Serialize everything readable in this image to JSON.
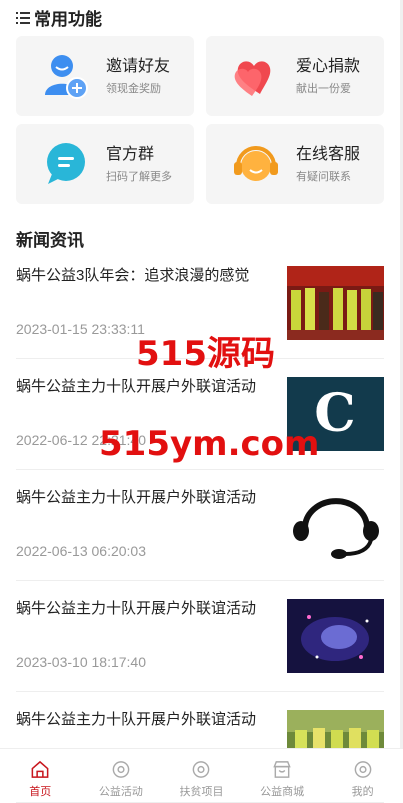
{
  "common": {
    "title": "常用功能",
    "items": [
      {
        "title": "邀请好友",
        "sub": "领现金奖励",
        "icon": "invite-user-icon"
      },
      {
        "title": "爱心捐款",
        "sub": "献出一份爱",
        "icon": "heart-donate-icon"
      },
      {
        "title": "官方群",
        "sub": "扫码了解更多",
        "icon": "chat-group-icon"
      },
      {
        "title": "在线客服",
        "sub": "有疑问联系",
        "icon": "headset-icon"
      }
    ]
  },
  "news": {
    "title": "新闻资讯",
    "items": [
      {
        "title": "蜗牛公益3队年会：追求浪漫的感觉",
        "date": "2023-01-15 23:33:11"
      },
      {
        "title": "蜗牛公益主力十队开展户外联谊活动",
        "date": "2022-06-12 22:21:40"
      },
      {
        "title": "蜗牛公益主力十队开展户外联谊活动",
        "date": "2022-06-13 06:20:03"
      },
      {
        "title": "蜗牛公益主力十队开展户外联谊活动",
        "date": "2023-03-10 18:17:40"
      },
      {
        "title": "蜗牛公益主力十队开展户外联谊活动",
        "date": ""
      }
    ]
  },
  "watermark": {
    "line1": "515源码",
    "line2": "515ym.com"
  },
  "tabs": [
    {
      "label": "首页",
      "icon": "home-icon",
      "active": true
    },
    {
      "label": "公益活动",
      "icon": "activity-icon",
      "active": false
    },
    {
      "label": "扶贫项目",
      "icon": "project-icon",
      "active": false
    },
    {
      "label": "公益商城",
      "icon": "shop-icon",
      "active": false
    },
    {
      "label": "我的",
      "icon": "profile-icon",
      "active": false
    }
  ],
  "colors": {
    "accent": "#c8161d",
    "watermark": "#e21010"
  }
}
